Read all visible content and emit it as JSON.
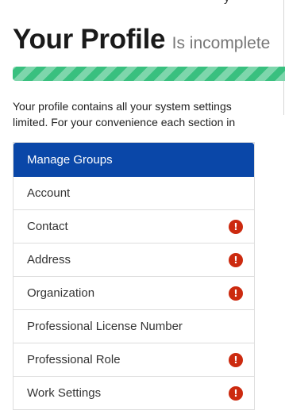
{
  "header": {
    "title": "Your Profile",
    "status": "Is incomplete",
    "top_fragment": "y"
  },
  "progress": {
    "fill_fraction": 1.0,
    "color": "#39c07f"
  },
  "intro": {
    "line1": "Your profile contains all your system settings",
    "line2": "limited. For your convenience each section in"
  },
  "menu": {
    "items": [
      {
        "label": "Manage Groups",
        "active": true,
        "alert": false
      },
      {
        "label": "Account",
        "active": false,
        "alert": false
      },
      {
        "label": "Contact",
        "active": false,
        "alert": true
      },
      {
        "label": "Address",
        "active": false,
        "alert": true
      },
      {
        "label": "Organization",
        "active": false,
        "alert": true
      },
      {
        "label": "Professional License Number",
        "active": false,
        "alert": false
      },
      {
        "label": "Professional Role",
        "active": false,
        "alert": true
      },
      {
        "label": "Work Settings",
        "active": false,
        "alert": true
      }
    ],
    "alert_glyph": "!",
    "alert_icon": "exclamation-circle-icon",
    "active_color": "#0a47a8",
    "alert_color": "#cc2a0f"
  }
}
